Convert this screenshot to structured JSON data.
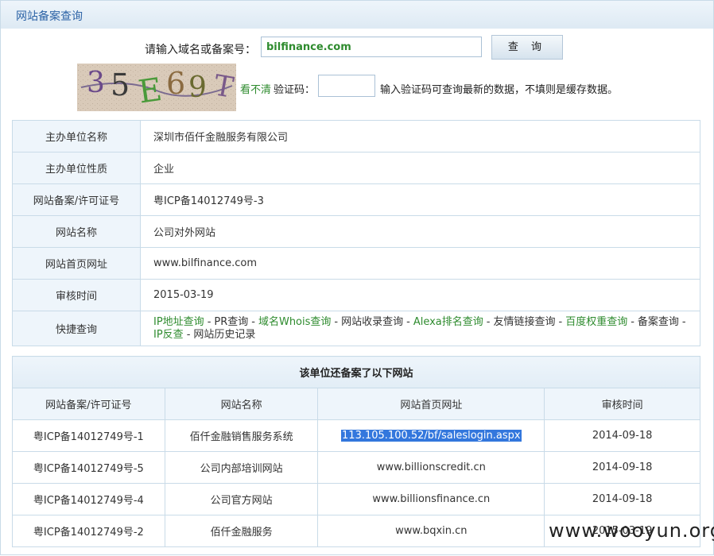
{
  "title": "网站备案查询",
  "query": {
    "label": "请输入域名或备案号：",
    "value": "bilfinance.com",
    "button": "查 询"
  },
  "captcha": {
    "image_text": "35E69T",
    "refresh_link": "看不清",
    "label": "验证码：",
    "value": "",
    "hint": "输入验证码可查询最新的数据，不填则是缓存数据。"
  },
  "info": {
    "rows": [
      {
        "key": "主办单位名称",
        "value": "深圳市佰仟金融服务有限公司"
      },
      {
        "key": "主办单位性质",
        "value": "企业"
      },
      {
        "key": "网站备案/许可证号",
        "value": "粤ICP备14012749号-3"
      },
      {
        "key": "网站名称",
        "value": "公司对外网站"
      },
      {
        "key": "网站首页网址",
        "value": "www.bilfinance.com"
      },
      {
        "key": "审核时间",
        "value": "2015-03-19"
      }
    ],
    "quick": {
      "key": "快捷查询",
      "items": [
        {
          "label": "IP地址查询",
          "green": true
        },
        {
          "label": "PR查询",
          "green": false
        },
        {
          "label": "域名Whois查询",
          "green": true
        },
        {
          "label": "网站收录查询",
          "green": false
        },
        {
          "label": "Alexa排名查询",
          "green": true
        },
        {
          "label": "友情链接查询",
          "green": false
        },
        {
          "label": "百度权重查询",
          "green": true
        },
        {
          "label": "备案查询",
          "green": false
        },
        {
          "label": "IP反查",
          "green": true
        },
        {
          "label": "网站历史记录",
          "green": false
        }
      ]
    }
  },
  "sites": {
    "caption": "该单位还备案了以下网站",
    "headers": [
      "网站备案/许可证号",
      "网站名称",
      "网站首页网址",
      "审核时间"
    ],
    "rows": [
      {
        "license": "粤ICP备14012749号-1",
        "name": "佰仟金融销售服务系统",
        "url": "113.105.100.52/bf/saleslogin.aspx",
        "date": "2014-09-18"
      },
      {
        "license": "粤ICP备14012749号-5",
        "name": "公司内部培训网站",
        "url": "www.billionscredit.cn",
        "date": "2014-09-18"
      },
      {
        "license": "粤ICP备14012749号-4",
        "name": "公司官方网站",
        "url": "www.billionsfinance.cn",
        "date": "2014-09-18"
      },
      {
        "license": "粤ICP备14012749号-2",
        "name": "佰仟金融服务",
        "url": "www.bqxin.cn",
        "date": "2015-03-19"
      }
    ]
  },
  "watermark": "www.wooyun.org",
  "colors": {
    "link_green": "#2e8b2e",
    "title_blue": "#2c63a6",
    "border": "#c9dbe8",
    "highlight": "#3377dd"
  }
}
